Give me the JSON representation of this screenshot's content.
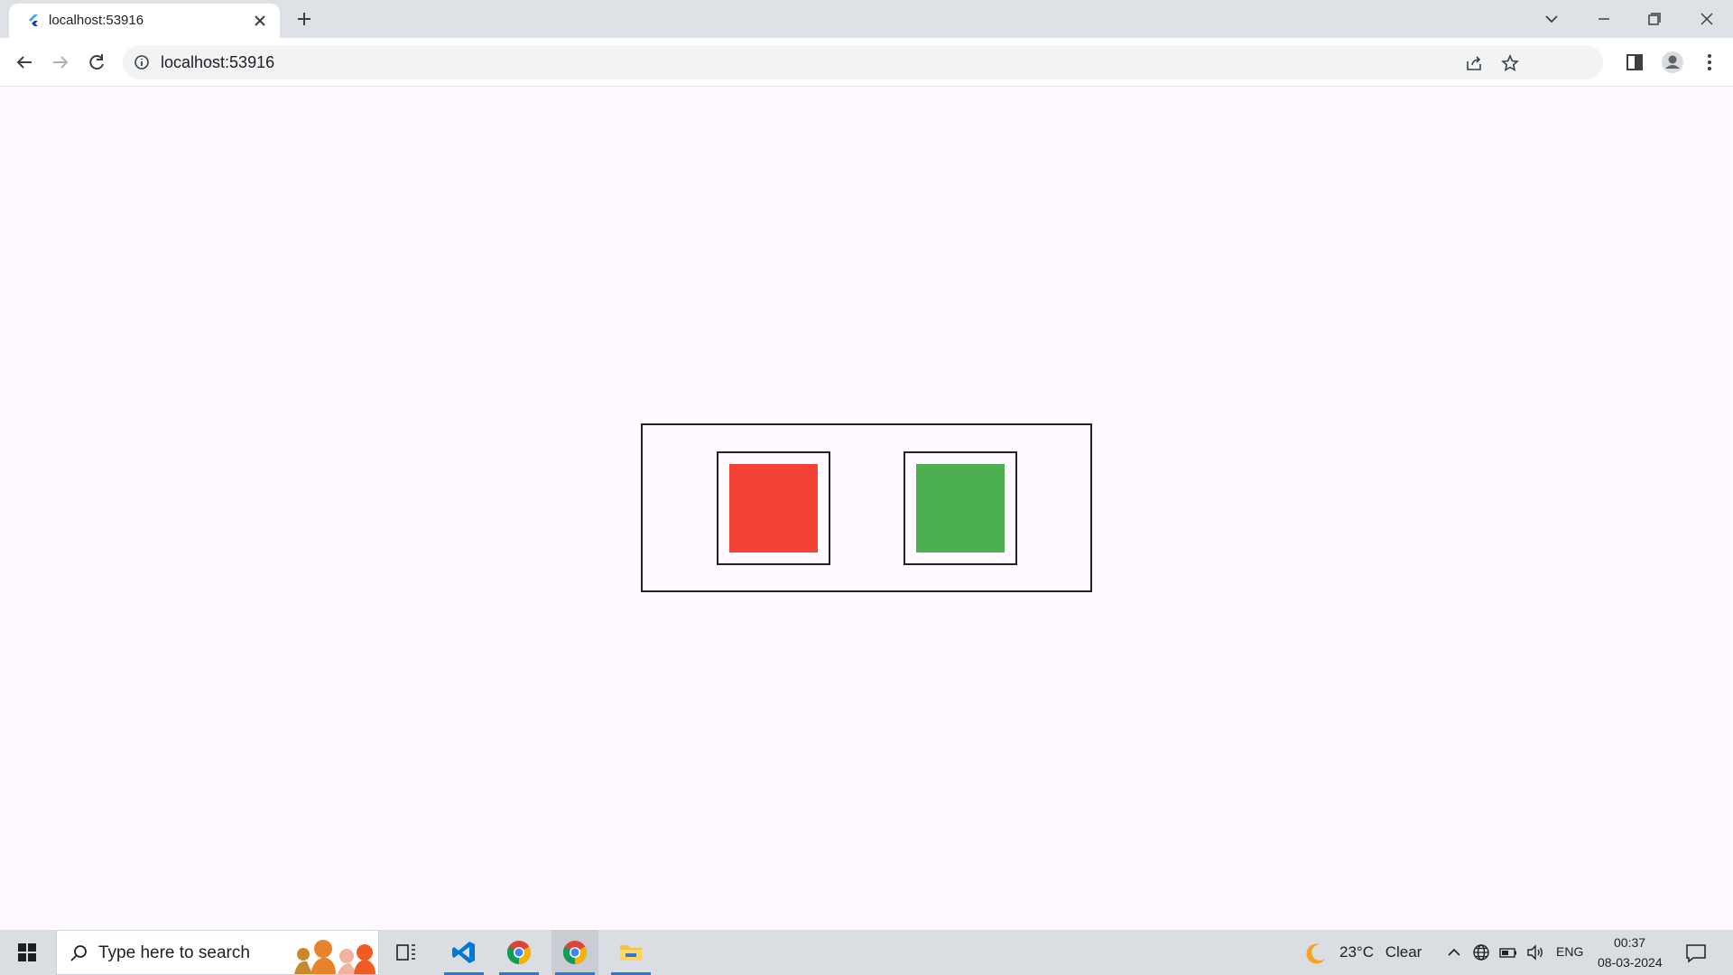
{
  "browser": {
    "tab": {
      "title": "localhost:53916"
    },
    "address_bar": {
      "url": "localhost:53916"
    }
  },
  "content": {
    "outer_border_color": "#222222",
    "boxes": [
      {
        "name": "red-square",
        "color": "#f44336"
      },
      {
        "name": "green-square",
        "color": "#4caf50"
      }
    ]
  },
  "taskbar": {
    "search_placeholder": "Type here to search",
    "weather": {
      "temperature": "23°C",
      "condition": "Clear"
    },
    "language": "ENG",
    "clock": {
      "time": "00:37",
      "date": "08-03-2024"
    },
    "apps": [
      "task-view",
      "vscode",
      "chrome",
      "chrome",
      "file-explorer"
    ]
  }
}
